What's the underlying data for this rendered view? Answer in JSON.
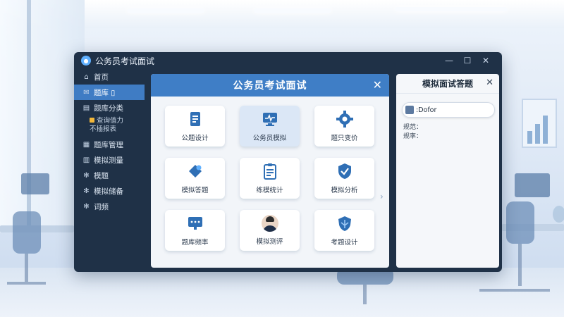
{
  "app": {
    "title": "公务员考试面试",
    "controls": {
      "minimize": "—",
      "maximize": "☐",
      "close": "✕"
    }
  },
  "sidebar": {
    "items": [
      {
        "label": "首页",
        "icon": "home-icon",
        "glyph": "⌂",
        "active": false
      },
      {
        "label": "题库 ▯",
        "icon": "mail-icon",
        "glyph": "✉",
        "active": true
      },
      {
        "label": "题库分类",
        "icon": "folder-icon",
        "glyph": "▤",
        "active": false
      },
      {
        "label": "题库管理",
        "icon": "grid-icon",
        "glyph": "▦",
        "active": false
      },
      {
        "label": "模拟测量",
        "icon": "chart-icon",
        "glyph": "▥",
        "active": false
      },
      {
        "label": "模题",
        "icon": "settings-icon",
        "glyph": "✻",
        "active": false
      },
      {
        "label": "模拟储备",
        "icon": "gear-icon",
        "glyph": "✻",
        "active": false
      },
      {
        "label": "词频",
        "icon": "search-icon",
        "glyph": "✻",
        "active": false
      }
    ],
    "sub": {
      "line1": "查询值力",
      "line2": "不插报表"
    }
  },
  "modal": {
    "title": "公务员考试面试",
    "close": "✕",
    "scroll_arrow": "›",
    "tiles": [
      {
        "label": "公题设计",
        "icon": "document-icon"
      },
      {
        "label": "公务员模拟",
        "icon": "monitor-icon"
      },
      {
        "label": "题只变价",
        "icon": "gear-icon"
      },
      {
        "label": "模拟答题",
        "icon": "tag-icon"
      },
      {
        "label": "练模统计",
        "icon": "clipboard-icon"
      },
      {
        "label": "模拟分析",
        "icon": "shield-check-icon"
      },
      {
        "label": "题库频率",
        "icon": "chat-icon"
      },
      {
        "label": "模拟测评",
        "icon": "avatar-icon"
      },
      {
        "label": "考题设计",
        "icon": "shield-icon"
      }
    ]
  },
  "panel": {
    "title": "模拟面试答题",
    "close": "✕",
    "input_value": ":Dofor",
    "field1": "规范：",
    "field2": "规率："
  },
  "colors": {
    "accent": "#3f7ec6",
    "sidebar_bg": "#1f3147",
    "active_item": "#3f7cc4"
  }
}
